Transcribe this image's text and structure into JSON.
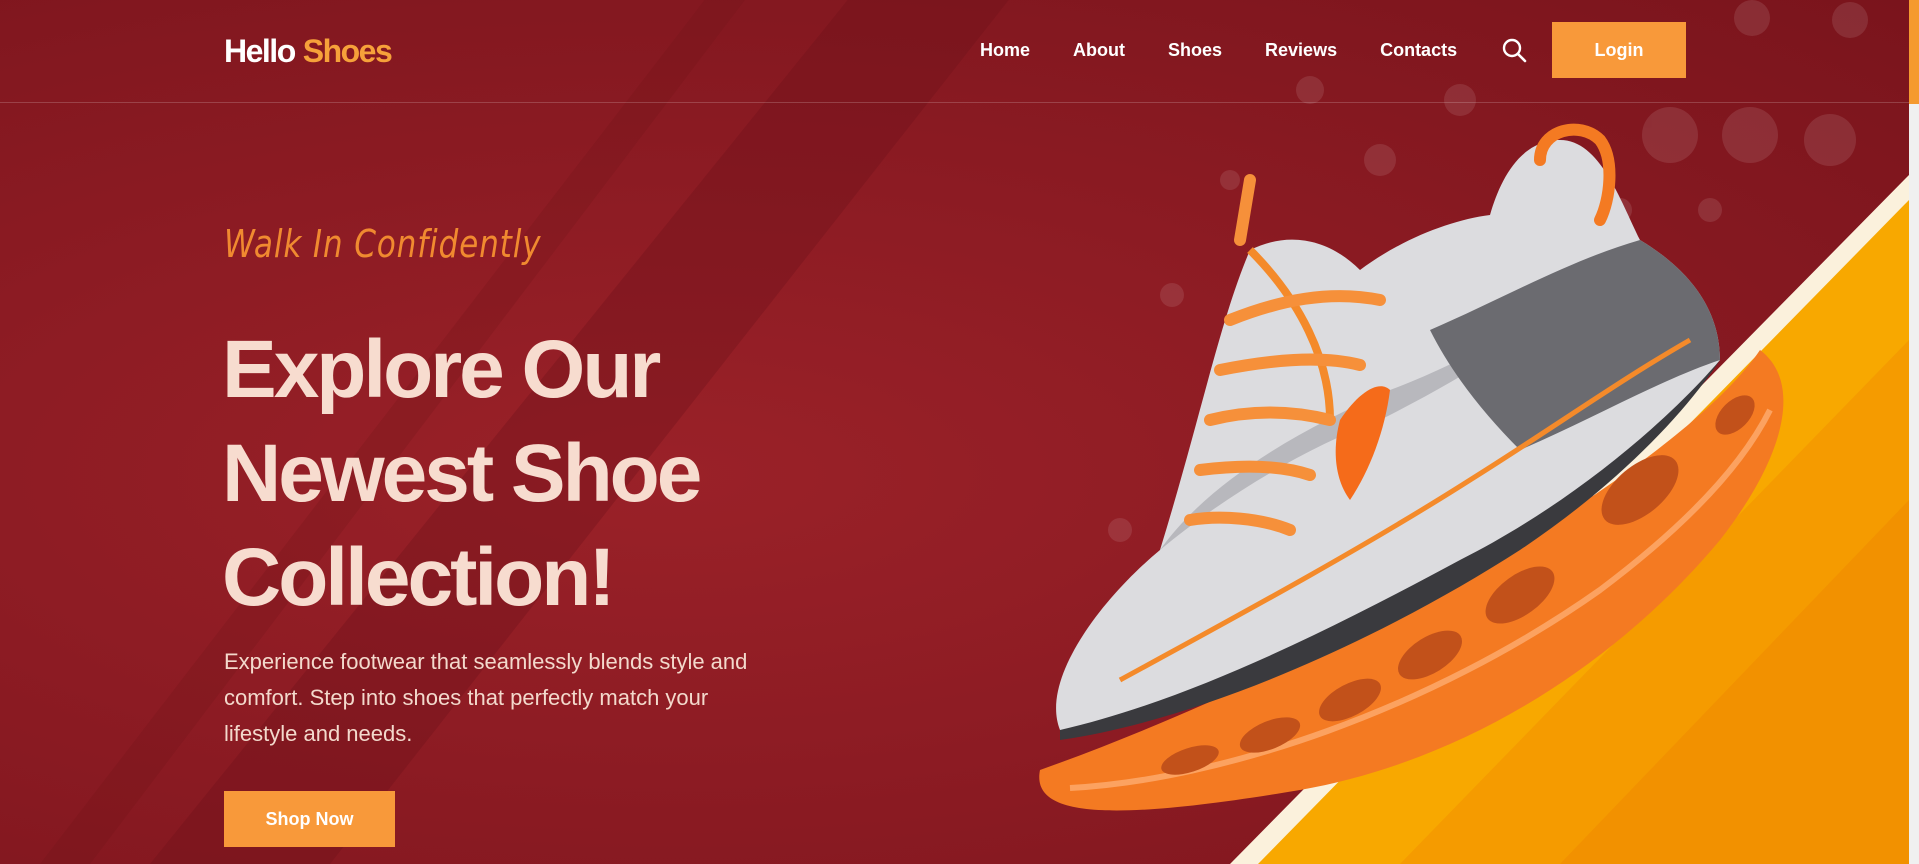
{
  "brand": {
    "word1": "Hello",
    "word2": "Shoes"
  },
  "nav": {
    "items": [
      "Home",
      "About",
      "Shoes",
      "Reviews",
      "Contacts"
    ],
    "search_icon": "search-icon",
    "login_label": "Login"
  },
  "hero": {
    "tagline": "Walk In Confidently",
    "headline_lines": [
      "Explore Our",
      "Newest Shoe",
      "Collection!"
    ],
    "subtext": "Experience footwear that seamlessly blends style and comfort. Step into shoes that perfectly match your lifestyle and needs.",
    "cta_label": "Shop Now",
    "image_subject": "sneaker"
  },
  "colors": {
    "background": "#8a1a22",
    "accent": "#f8993a",
    "headline": "#f7dccf",
    "stripe": "#f5a300"
  }
}
